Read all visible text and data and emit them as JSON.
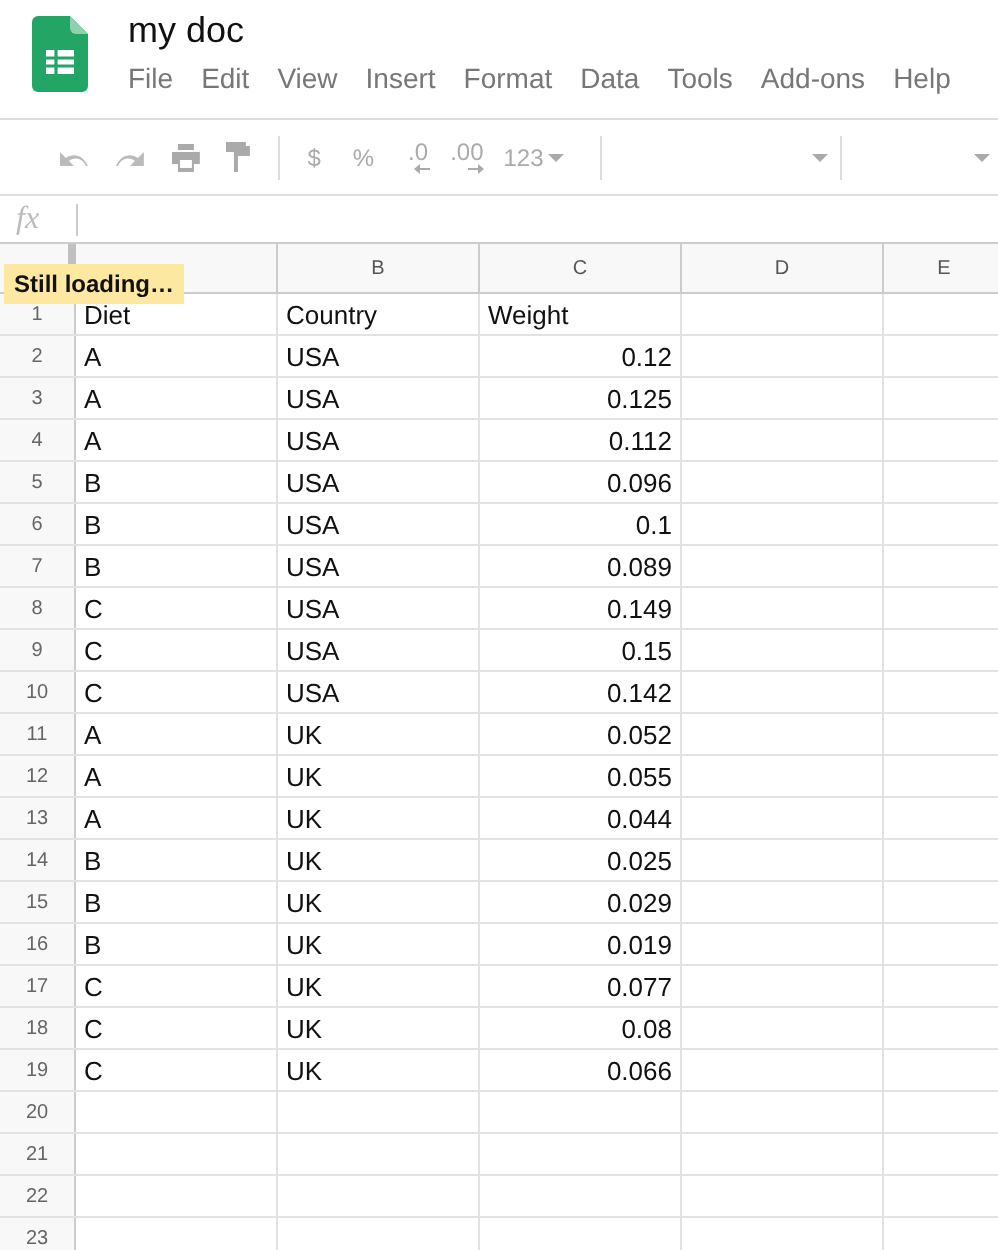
{
  "document": {
    "title": "my doc"
  },
  "menu": [
    "File",
    "Edit",
    "View",
    "Insert",
    "Format",
    "Data",
    "Tools",
    "Add-ons",
    "Help"
  ],
  "toolbar": [
    {
      "kind": "undo"
    },
    {
      "kind": "redo"
    },
    {
      "kind": "print"
    },
    {
      "kind": "paint"
    },
    {
      "kind": "sep"
    },
    {
      "kind": "text",
      "label": "$"
    },
    {
      "kind": "text",
      "label": "%"
    },
    {
      "kind": "decdown",
      "label": ".0"
    },
    {
      "kind": "decup",
      "label": ".00"
    },
    {
      "kind": "menu",
      "label": "123"
    },
    {
      "kind": "sep"
    },
    {
      "kind": "fontmenu"
    },
    {
      "kind": "sep"
    },
    {
      "kind": "sizemenu"
    }
  ],
  "formula_bar": {
    "label": "fx"
  },
  "tooltip": "Still loading…",
  "columns": [
    {},
    {
      "letter": "B"
    },
    {
      "letter": "C"
    },
    {
      "letter": "D"
    },
    {
      "letter": "E"
    }
  ],
  "rows": [
    {
      "number": "1",
      "cells": [
        "Diet",
        "Country",
        "Weight"
      ]
    },
    {
      "number": "2",
      "cells": [
        "A",
        "USA",
        "0.12"
      ]
    },
    {
      "number": "3",
      "cells": [
        "A",
        "USA",
        "0.125"
      ]
    },
    {
      "number": "4",
      "cells": [
        "A",
        "USA",
        "0.112"
      ]
    },
    {
      "number": "5",
      "cells": [
        "B",
        "USA",
        "0.096"
      ]
    },
    {
      "number": "6",
      "cells": [
        "B",
        "USA",
        "0.1"
      ]
    },
    {
      "number": "7",
      "cells": [
        "B",
        "USA",
        "0.089"
      ]
    },
    {
      "number": "8",
      "cells": [
        "C",
        "USA",
        "0.149"
      ]
    },
    {
      "number": "9",
      "cells": [
        "C",
        "USA",
        "0.15"
      ]
    },
    {
      "number": "10",
      "cells": [
        "C",
        "USA",
        "0.142"
      ]
    },
    {
      "number": "11",
      "cells": [
        "A",
        "UK",
        "0.052"
      ]
    },
    {
      "number": "12",
      "cells": [
        "A",
        "UK",
        "0.055"
      ]
    },
    {
      "number": "13",
      "cells": [
        "A",
        "UK",
        "0.044"
      ]
    },
    {
      "number": "14",
      "cells": [
        "B",
        "UK",
        "0.025"
      ]
    },
    {
      "number": "15",
      "cells": [
        "B",
        "UK",
        "0.029"
      ]
    },
    {
      "number": "16",
      "cells": [
        "B",
        "UK",
        "0.019"
      ]
    },
    {
      "number": "17",
      "cells": [
        "C",
        "UK",
        "0.077"
      ]
    },
    {
      "number": "18",
      "cells": [
        "C",
        "UK",
        "0.08"
      ]
    },
    {
      "number": "19",
      "cells": [
        "C",
        "UK",
        "0.066"
      ]
    },
    {
      "number": "20",
      "cells": []
    },
    {
      "number": "21",
      "cells": []
    },
    {
      "number": "22",
      "cells": []
    },
    {
      "number": "23",
      "cells": []
    }
  ]
}
